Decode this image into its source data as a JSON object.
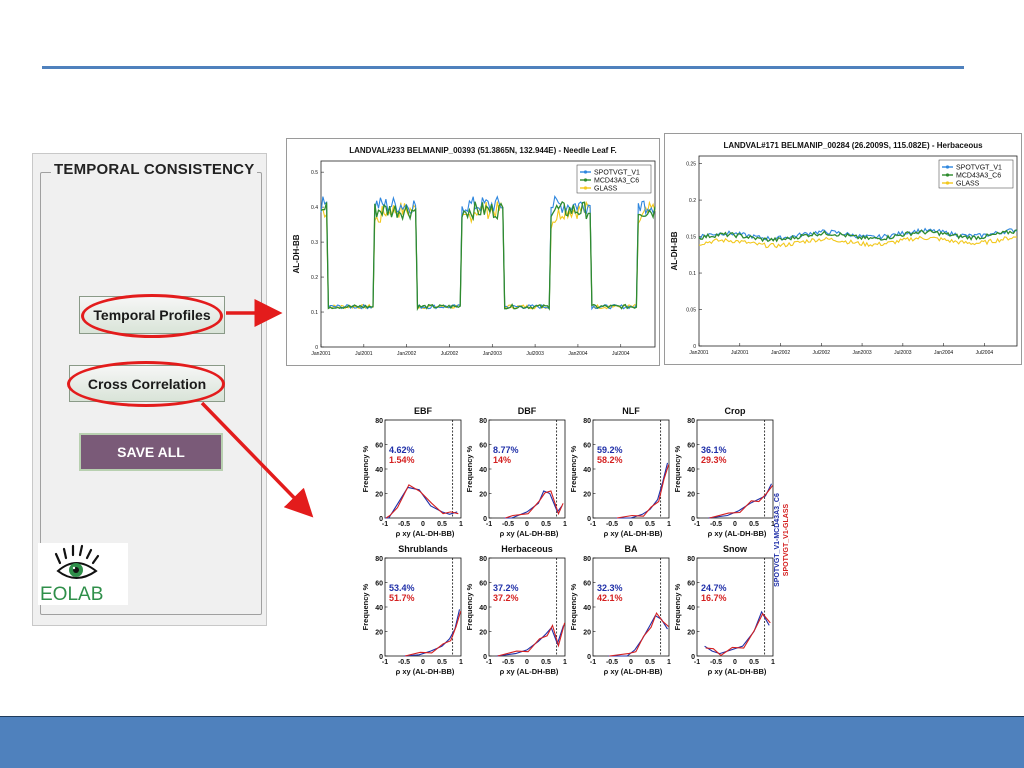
{
  "panel": {
    "title": "TEMPORAL CONSISTENCY",
    "buttons": {
      "temporal_profiles": "Temporal Profiles",
      "cross_correlation": "Cross Correlation",
      "save_all": "SAVE ALL"
    },
    "logo_text": "EOLAB"
  },
  "colors": {
    "spot": "#2e86de",
    "mcd": "#2e8b2e",
    "glass": "#f2c81e",
    "blue_line": "#1f2fa8",
    "red_line": "#d42020",
    "accent": "#4f81bd",
    "highlight": "#e31c1c"
  },
  "icons": [
    "eolab-eye-logo",
    "arrow-right-icon",
    "arrow-diagonal-icon"
  ],
  "figure1": {
    "title": "LANDVAL#233 BELMANIP_00393 (51.3865N, 132.944E) - Needle Leaf F.",
    "ylabel": "AL-DH-BB",
    "yticks": [
      "0",
      "0.1",
      "0.2",
      "0.3",
      "0.4",
      "0.5"
    ],
    "xticks": [
      "Jan2001",
      "Jul2001",
      "Jan2002",
      "Jul2002",
      "Jan2003",
      "Jul2003",
      "Jan2004",
      "Jul2004"
    ],
    "legend": [
      "SPOTVGT_V1",
      "MCD43A3_C6",
      "GLASS"
    ]
  },
  "figure2": {
    "title": "LANDVAL#171 BELMANIP_00284 (26.2009S, 115.082E) - Herbaceous",
    "ylabel": "AL-DH-BB",
    "yticks": [
      "0",
      "0.05",
      "0.1",
      "0.15",
      "0.2",
      "0.25"
    ],
    "xticks": [
      "Jan2001",
      "Jul2001",
      "Jan2002",
      "Jul2002",
      "Jan2003",
      "Jul2003",
      "Jan2004",
      "Jul2004"
    ],
    "legend": [
      "SPOTVGT_V1",
      "MCD43A3_C6",
      "GLASS"
    ]
  },
  "histograms": {
    "xlabel": "ρ xy (AL-DH-BB)",
    "ylabel": "Frequency %",
    "xticks": [
      "-1",
      "-0.5",
      "0",
      "0.5",
      "1"
    ],
    "yticks": [
      "0",
      "20",
      "40",
      "60",
      "80"
    ],
    "side_legend": [
      "SPOTVGT_V1-MCD43A3_C6",
      "SPOTVGT_V1-GLASS"
    ],
    "panels": [
      {
        "title": "EBF",
        "blue_pct": "4.62%",
        "red_pct": "1.54%"
      },
      {
        "title": "DBF",
        "blue_pct": "8.77%",
        "red_pct": "14%"
      },
      {
        "title": "NLF",
        "blue_pct": "59.2%",
        "red_pct": "58.2%"
      },
      {
        "title": "Crop",
        "blue_pct": "36.1%",
        "red_pct": "29.3%"
      },
      {
        "title": "Shrublands",
        "blue_pct": "53.4%",
        "red_pct": "51.7%"
      },
      {
        "title": "Herbaceous",
        "blue_pct": "37.2%",
        "red_pct": "37.2%"
      },
      {
        "title": "BA",
        "blue_pct": "32.3%",
        "red_pct": "42.1%"
      },
      {
        "title": "Snow",
        "blue_pct": "24.7%",
        "red_pct": "16.7%"
      }
    ]
  }
}
